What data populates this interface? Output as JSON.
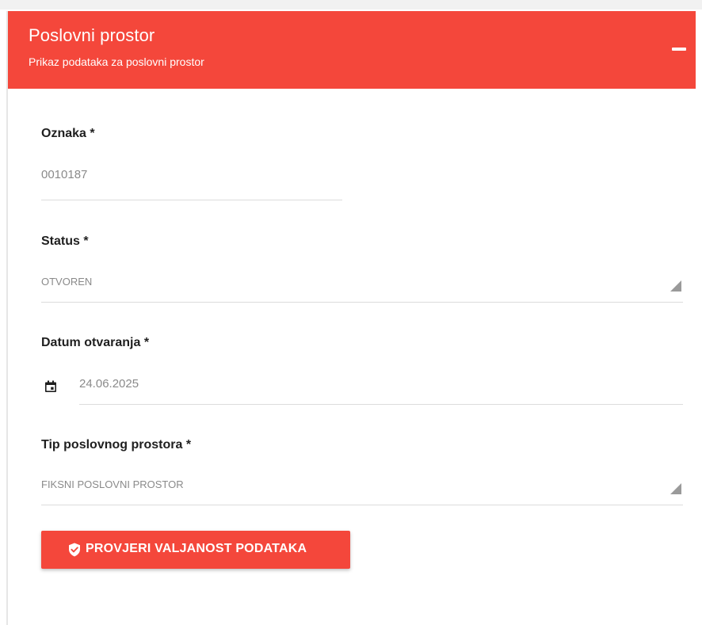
{
  "card": {
    "title": "Poslovni prostor",
    "subtitle": "Prikaz podataka za poslovni prostor",
    "collapse_icon": "minus-icon",
    "accent_color": "#f4473b"
  },
  "fields": {
    "oznaka": {
      "label": "Oznaka *",
      "value": "0010187"
    },
    "status": {
      "label": "Status *",
      "value": "OTVOREN"
    },
    "datum": {
      "label": "Datum otvaranja *",
      "value": "24.06.2025",
      "icon": "calendar-icon"
    },
    "tip": {
      "label": "Tip poslovnog prostora *",
      "value": "FIKSNI POSLOVNI PROSTOR"
    }
  },
  "actions": {
    "validate_label": "PROVJERI VALJANOST PODATAKA",
    "validate_icon": "shield-check-icon"
  }
}
